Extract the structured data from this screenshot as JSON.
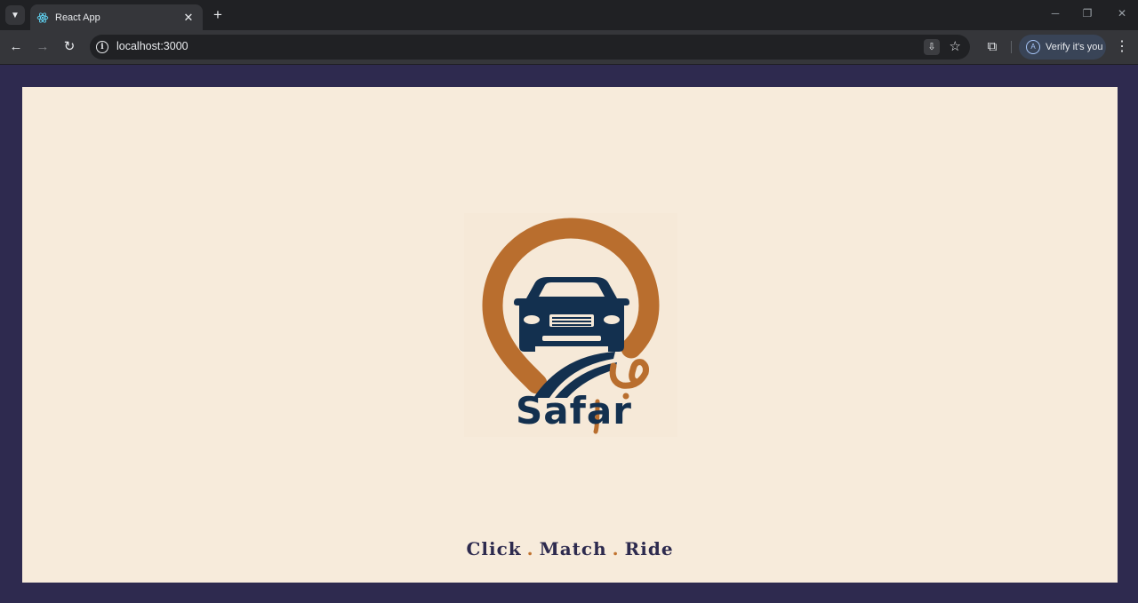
{
  "browser": {
    "tab_title": "React App",
    "url": "localhost:3000",
    "profile_label": "Verify it's you",
    "profile_initial": "A"
  },
  "logo": {
    "wordmark": "Safar",
    "arabic_mark": "بم"
  },
  "tagline": {
    "word1": "Click",
    "word2": "Match",
    "word3": "Ride",
    "separator": "."
  },
  "colors": {
    "page_bg": "#f7ebdb",
    "outer_bg": "#2e2a4f",
    "brand_orange": "#c0722f",
    "brand_navy": "#13304f",
    "tagline": "#2d2a4e"
  }
}
